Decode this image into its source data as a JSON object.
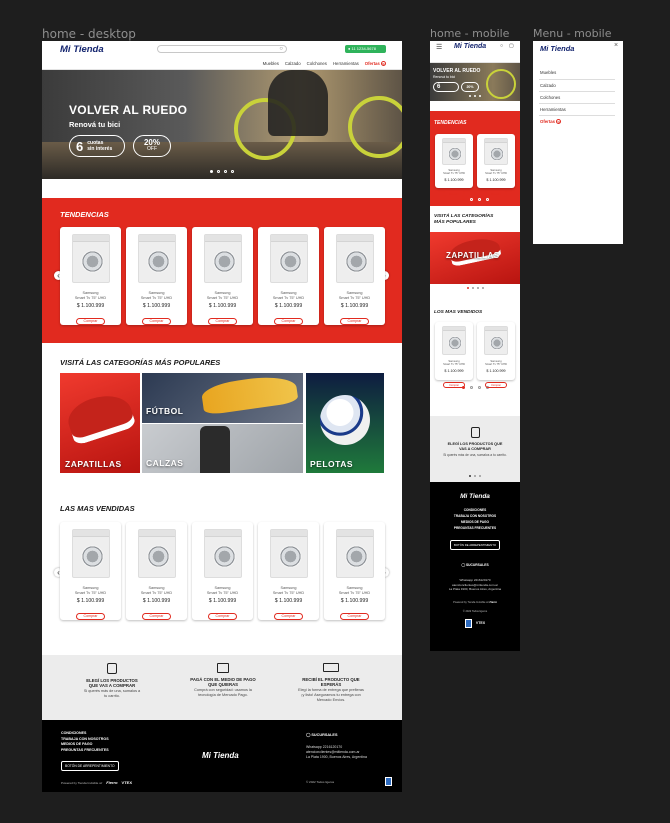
{
  "frames": {
    "desktop": "home - desktop",
    "mobile": "home - mobile",
    "menu": "Menu - mobile"
  },
  "brand": {
    "logo": "Mi Tienda"
  },
  "header": {
    "nav": [
      "Muebles",
      "Calzado",
      "Colchones",
      "Herramientas"
    ],
    "offers": "Ofertas",
    "whatsapp": "11 1234-5678"
  },
  "hero": {
    "title": "VOLVER AL RUEDO",
    "subtitle": "Renová tu bici",
    "badge_number": "6",
    "badge_text1": "cuotas",
    "badge_text2": "sin interés",
    "discount_big": "20%",
    "discount_small": "OFF"
  },
  "sections": {
    "trends": "TENDENCIAS",
    "categories": "VISITÁ LAS CATEGORÍAS MÁS POPULARES",
    "categories_m1": "VISITÁ LAS CATEGORÍAS",
    "categories_m2": "MÁS POPULARES",
    "bestsellers": "LAS MAS VENDIDAS",
    "bestsellers_mobile": "LOS MAS VENDIDOS"
  },
  "product": {
    "brand": "Samsung",
    "name": "Smart Tv 75\" UHD",
    "price": "$ 1.100.999",
    "cta": "Comprar"
  },
  "categories": [
    "ZAPATILLAS",
    "FÚTBOL",
    "CALZAS",
    "PELOTAS"
  ],
  "features": [
    {
      "title": "ELEGÍ LOS PRODUCTOS QUE VAS A COMPRAR",
      "text": "Si querés más de una, sumalos a tu carrito."
    },
    {
      "title": "PAGÁ CON EL MEDIO DE PAGO QUE QUIERAS",
      "text": "Comprá con seguridad: usamos la tecnología de Mercado Pago."
    },
    {
      "title": "RECIBÍ EL PRODUCTO QUE ESPERÁS",
      "text": "Elegí la forma de entrega que prefieras ¡y listo! Aseguramos tu entrega con Mercado Envíos."
    }
  ],
  "footer": {
    "links": [
      "CONDICIONES",
      "TRABAJA CON NOSOTROS",
      "MEDIOS DE PAGO",
      "PREGUNTAS FRECUENTES"
    ],
    "regret_button": "BOTÓN DE ARREPENTIMIENTO",
    "branches": "SUCURSALES",
    "phone": "Whatsapp 2216120170",
    "email": "atencionclientes@mitienda.com.ar",
    "address": "La Plata 1900, Buenos Aires, Argentina",
    "powered": "Powered by Tienda Invisible w/",
    "fierro": "Fierro",
    "vtex": "VTEX",
    "copyright": "© 2022 Todos ligeros"
  },
  "menu": {
    "items": [
      "Muebles",
      "Calzado",
      "Colchones",
      "Herramientas"
    ],
    "offers": "Ofertas",
    "close": "×"
  },
  "colors": {
    "accent": "#e12a1f",
    "brand": "#13246e",
    "whatsapp": "#2fb35b",
    "dark": "#000000",
    "feature_bg": "#ececec"
  }
}
